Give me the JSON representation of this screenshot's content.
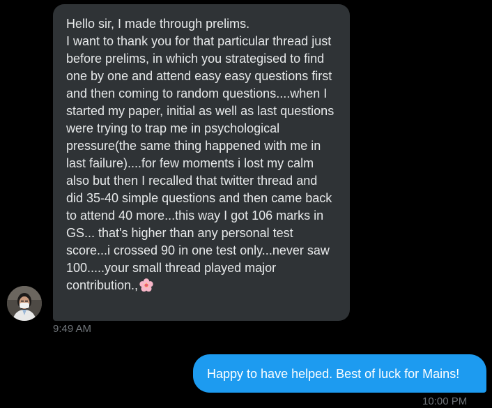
{
  "conversation": {
    "incoming_message": {
      "text": "Hello sir, I made through prelims.\nI want to thank you for that particular thread just before prelims, in which you strategised to find one by one and attend easy easy questions first and then coming to random questions....when I started my paper, initial as well as last questions were trying to trap me in psychological pressure(the same thing happened with me in last failure)....for few moments i lost my calm also but then I recalled that twitter thread and did 35-40 simple questions and then came back to attend 40 more...this way I got 106 marks in GS... that's higher than any personal test score...i crossed 90 in one test only...never saw 100.....your small thread played major contribution.,",
      "emoji": "cherry-blossom-emoji",
      "time": "9:49 AM"
    },
    "outgoing_message": {
      "text": "Happy to have helped. Best of luck for Mains!",
      "time": "10:00 PM"
    },
    "colors": {
      "background": "#000000",
      "incoming_bubble": "#2f3336",
      "outgoing_bubble": "#1d9bf0",
      "timestamp": "#71767b"
    }
  }
}
